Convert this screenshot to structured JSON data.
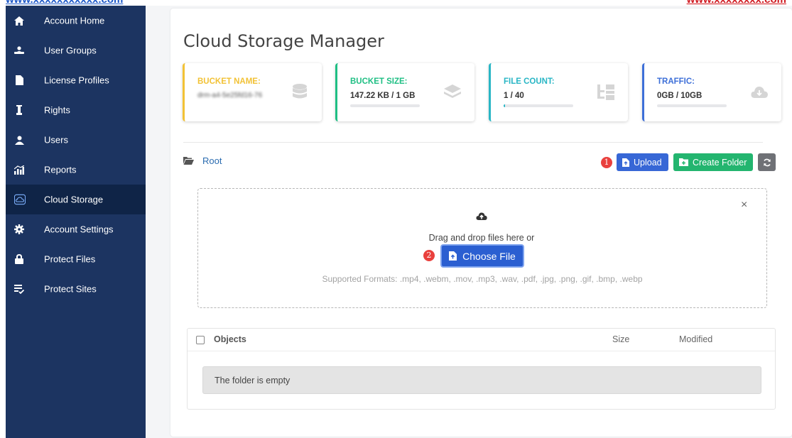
{
  "watermark": {
    "left": "www.xxxxxxxxxxx.com",
    "right": "www.xxxxxxxx.com"
  },
  "sidebar": {
    "items": [
      {
        "label": "Account Home",
        "icon": "home-icon"
      },
      {
        "label": "User Groups",
        "icon": "user-group-icon"
      },
      {
        "label": "License Profiles",
        "icon": "file-icon"
      },
      {
        "label": "Rights",
        "icon": "rights-icon"
      },
      {
        "label": "Users",
        "icon": "user-icon"
      },
      {
        "label": "Reports",
        "icon": "chart-icon"
      },
      {
        "label": "Cloud Storage",
        "icon": "cloud-icon",
        "active": true
      },
      {
        "label": "Account Settings",
        "icon": "gear-icon"
      },
      {
        "label": "Protect Files",
        "icon": "lock-icon"
      },
      {
        "label": "Protect Sites",
        "icon": "list-check-icon"
      }
    ]
  },
  "main": {
    "title": "Cloud Storage Manager",
    "stats": [
      {
        "title": "BUCKET NAME:",
        "value": "drm-a4-5e25fd16-76",
        "color": "#f2c236",
        "icon": "database-icon",
        "progress": null
      },
      {
        "title": "BUCKET SIZE:",
        "value": "147.22 KB / 1 GB",
        "color": "#1fbf84",
        "icon": "layers-icon",
        "progress": 0.0
      },
      {
        "title": "FILE COUNT:",
        "value": "1 / 40",
        "color": "#29b6c5",
        "icon": "sitemap-icon",
        "progress": 0.025
      },
      {
        "title": "TRAFFIC:",
        "value": "0GB / 10GB",
        "color": "#3d6fd8",
        "icon": "cloud-download-icon",
        "progress": 0.0
      }
    ],
    "breadcrumb": "Root",
    "toolbar": {
      "marker1": "1",
      "upload_label": "Upload",
      "create_folder_label": "Create Folder"
    },
    "dropzone": {
      "drag_text": "Drag and drop files here or",
      "marker2": "2",
      "choose_label": "Choose File",
      "formats": "Supported Formats: .mp4, .webm, .mov, .mp3, .wav, .pdf, .jpg, .png, .gif, .bmp, .webp",
      "close": "×"
    },
    "table": {
      "columns": [
        "Objects",
        "Size",
        "Modified"
      ],
      "empty_text": "The folder is empty"
    }
  }
}
